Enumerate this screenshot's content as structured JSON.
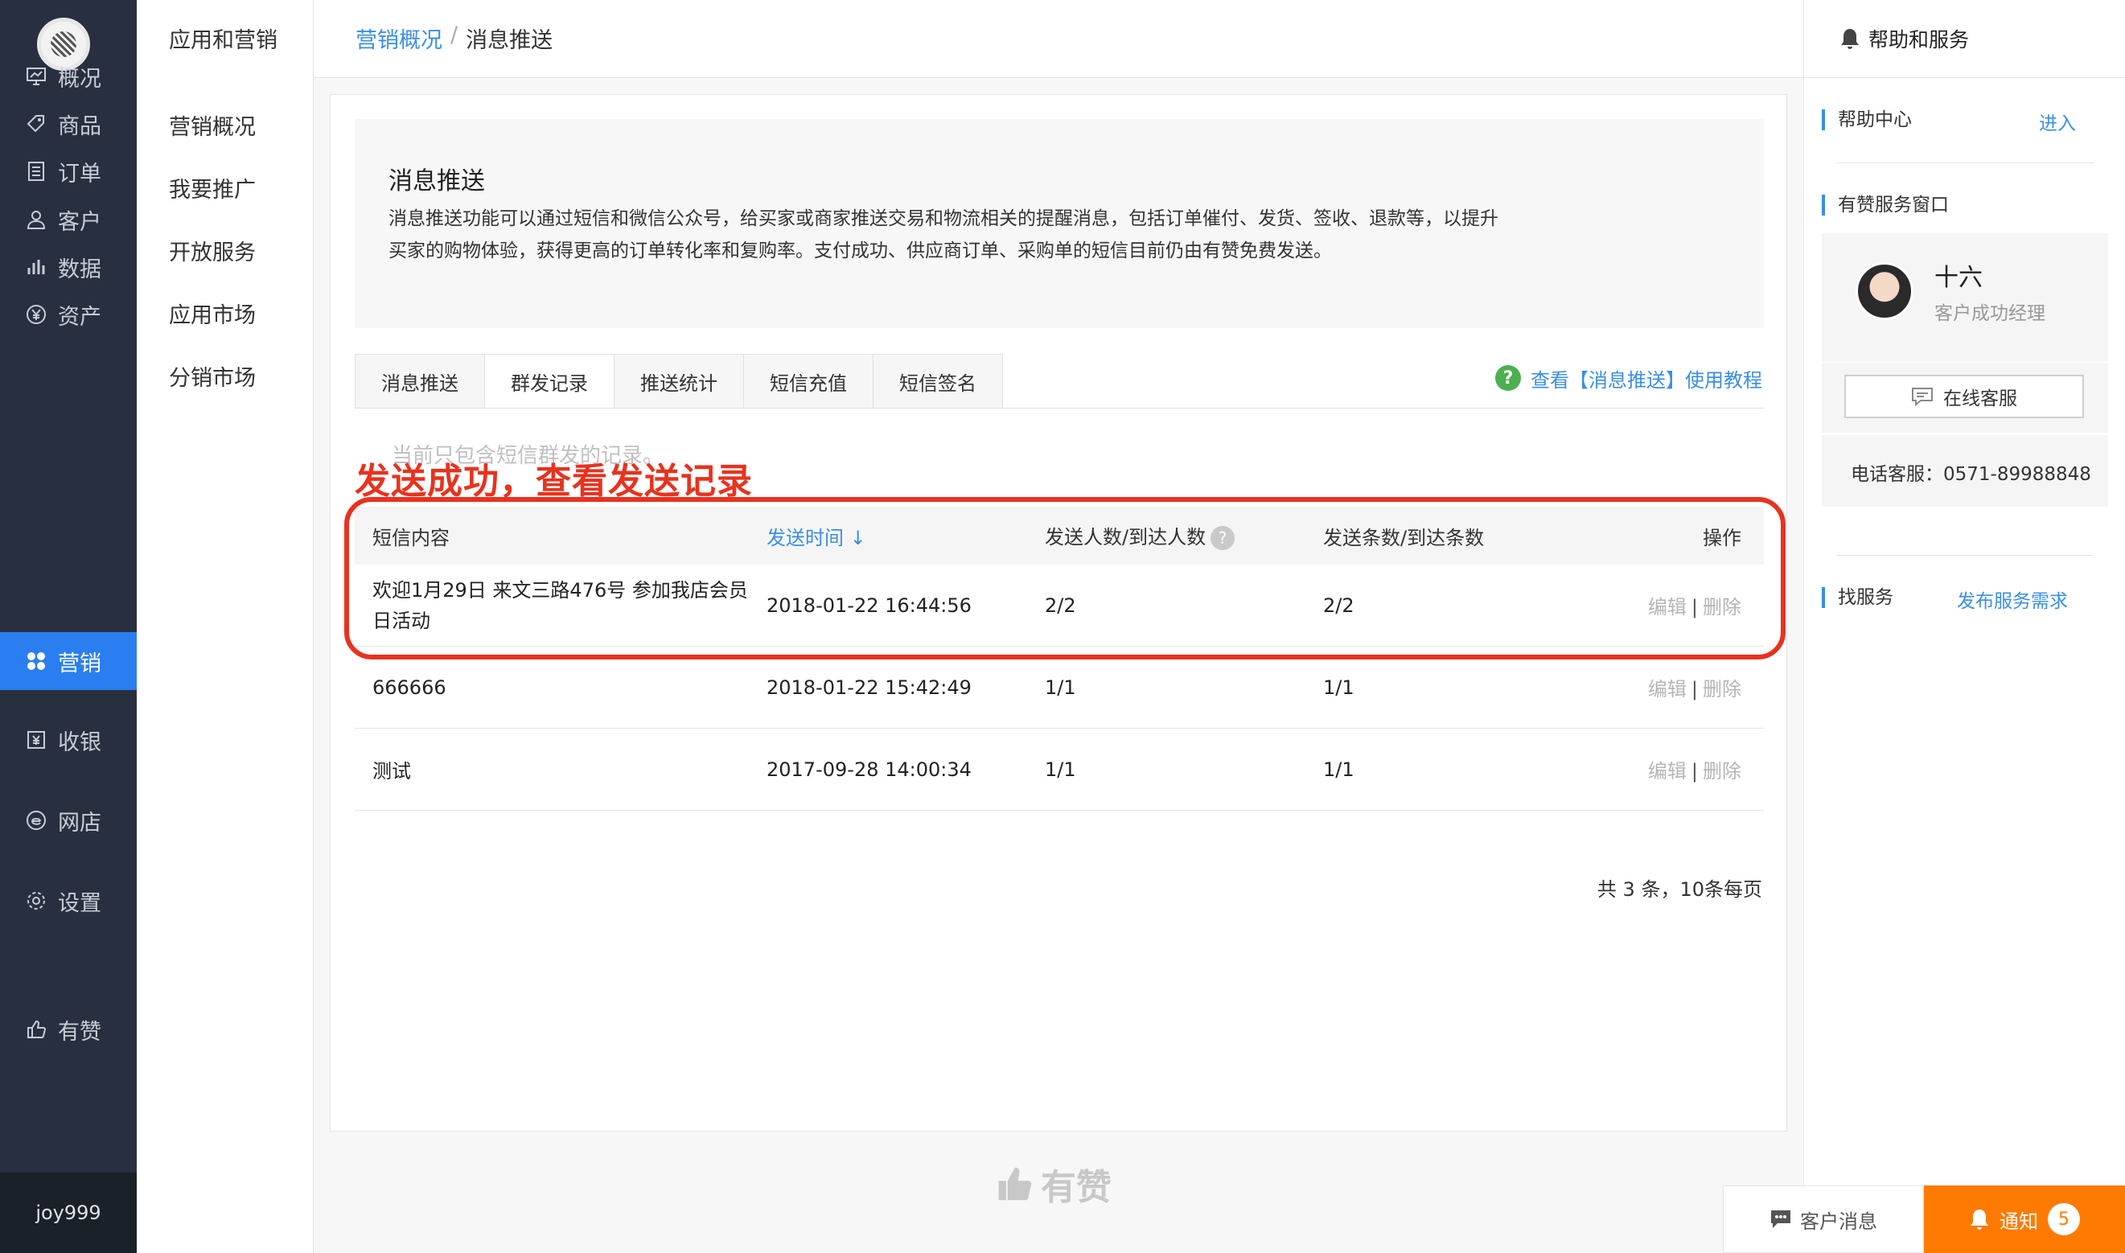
{
  "sidebar": {
    "items": [
      {
        "label": "概况",
        "icon": "overview-icon"
      },
      {
        "label": "商品",
        "icon": "tag-icon"
      },
      {
        "label": "订单",
        "icon": "order-icon"
      },
      {
        "label": "客户",
        "icon": "user-icon"
      },
      {
        "label": "数据",
        "icon": "chart-icon"
      },
      {
        "label": "资产",
        "icon": "yen-icon"
      },
      {
        "label": "营销",
        "icon": "marketing-icon"
      },
      {
        "label": "收银",
        "icon": "cashier-icon"
      },
      {
        "label": "网店",
        "icon": "shop-icon"
      },
      {
        "label": "设置",
        "icon": "gear-icon"
      },
      {
        "label": "有赞",
        "icon": "thumb-icon"
      }
    ],
    "active": "营销",
    "user": "joy999"
  },
  "subnav": {
    "title": "应用和营销",
    "items": [
      "营销概况",
      "我要推广",
      "开放服务",
      "应用市场",
      "分销市场"
    ]
  },
  "breadcrumb": {
    "parent": "营销概况",
    "sep": "/",
    "current": "消息推送"
  },
  "intro": {
    "title": "消息推送",
    "text": "消息推送功能可以通过短信和微信公众号，给买家或商家推送交易和物流相关的提醒消息，包括订单催付、发货、签收、退款等，以提升买家的购物体验，获得更高的订单转化率和复购率。支付成功、供应商订单、采购单的短信目前仍由有赞免费发送。"
  },
  "tabs": [
    "消息推送",
    "群发记录",
    "推送统计",
    "短信充值",
    "短信签名"
  ],
  "active_tab": "群发记录",
  "help_link": "查看【消息推送】使用教程",
  "note": "当前只包含短信群发的记录。",
  "annotation": "发送成功，查看发送记录",
  "table": {
    "headers": {
      "content": "短信内容",
      "time": "发送时间 ↓",
      "people": "发送人数/到达人数",
      "count": "发送条数/到达条数",
      "ops": "操作"
    },
    "rows": [
      {
        "content": "欢迎1月29日 来文三路476号 参加我店会员日活动",
        "time": "2018-01-22 16:44:56",
        "people": "2/2",
        "count": "2/2",
        "edit": "编辑",
        "delete": "删除"
      },
      {
        "content": "666666",
        "time": "2018-01-22 15:42:49",
        "people": "1/1",
        "count": "1/1",
        "edit": "编辑",
        "delete": "删除"
      },
      {
        "content": "测试",
        "time": "2017-09-28 14:00:34",
        "people": "1/1",
        "count": "1/1",
        "edit": "编辑",
        "delete": "删除"
      }
    ],
    "op_sep": "|"
  },
  "pager": "共 3 条，10条每页",
  "footer_logo": "有赞",
  "right_panel": {
    "header": "帮助和服务",
    "help_center": "帮助中心",
    "enter": "进入",
    "service_window": "有赞服务窗口",
    "manager_name": "十六",
    "manager_role": "客户成功经理",
    "online_service": "在线客服",
    "phone": "电话客服：0571-89988848",
    "find_service": "找服务",
    "post_need": "发布服务需求"
  },
  "bottom_bar": {
    "messages": "客户消息",
    "notice": "通知",
    "notice_count": "5"
  },
  "colors": {
    "accent": "#2b7ef0",
    "link": "#3a8ee6",
    "highlight": "#e8321e",
    "notice": "#ff7a00",
    "sidebar": "#283040"
  }
}
